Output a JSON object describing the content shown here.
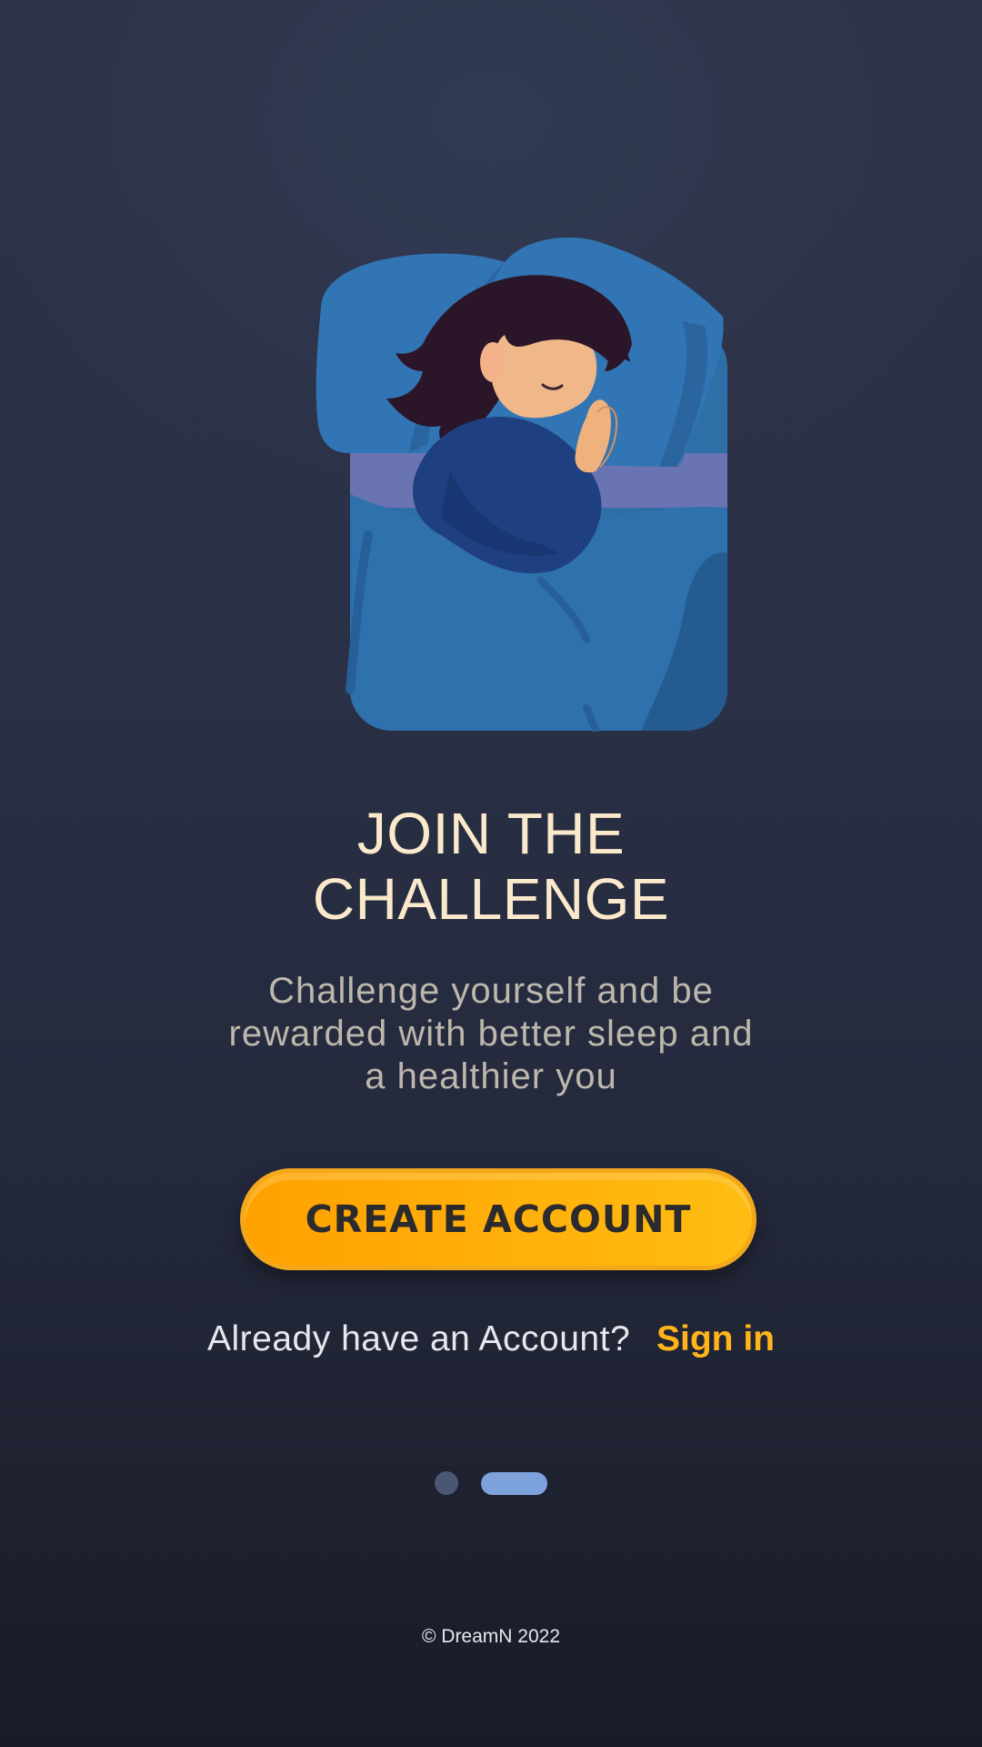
{
  "onboarding": {
    "title_line1": "JOIN THE",
    "title_line2": "CHALLENGE",
    "subtitle_line1": "Challenge yourself and be",
    "subtitle_line2": "rewarded with better sleep and",
    "subtitle_line3": "a healthier you",
    "illustration_icon": "sleeping-woman-illustration",
    "create_account_label": "CREATE ACCOUNT",
    "signin_prompt": "Already have an Account?",
    "signin_label": "Sign in",
    "pager": {
      "page_count": 2,
      "active_page": 2
    },
    "footer": "© DreamN 2022"
  },
  "colors": {
    "background": "#2a3045",
    "title": "#fbe9cc",
    "subtitle": "#bdb7ad",
    "button": "#ffb00b",
    "button_text": "#2b2a2c",
    "link": "#ffb51a",
    "pager_active": "#7ea3dc",
    "pager_inactive": "#4a5673"
  }
}
